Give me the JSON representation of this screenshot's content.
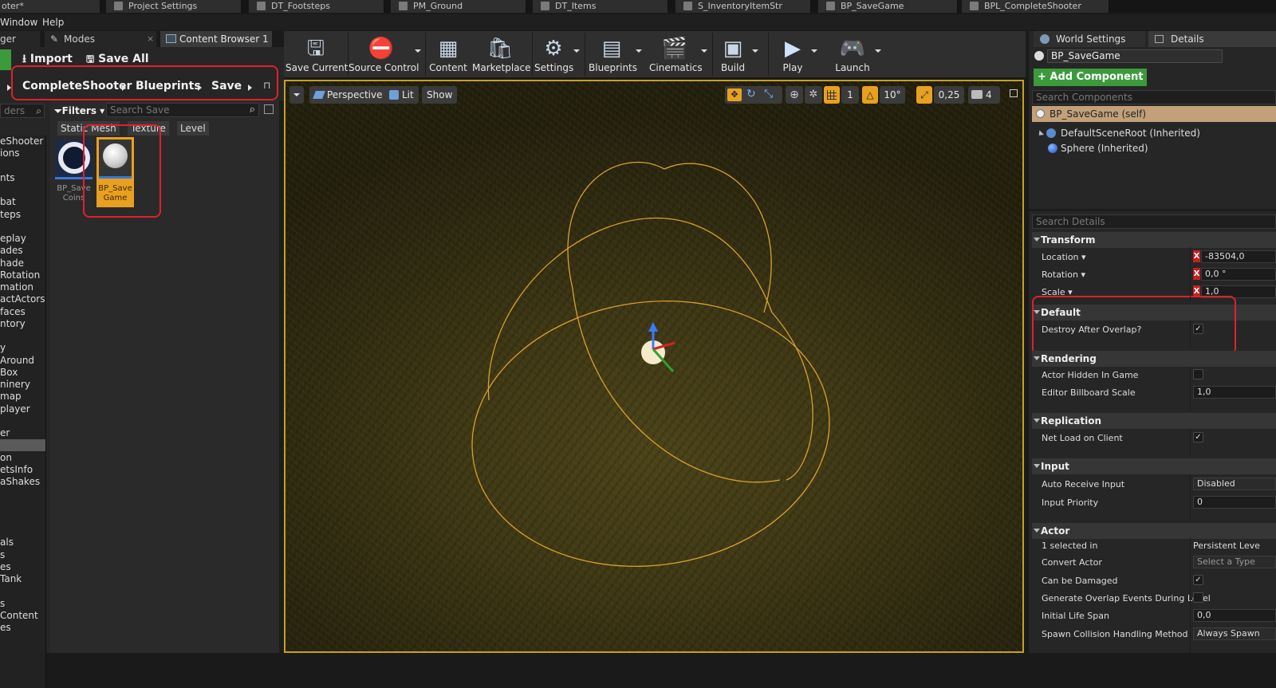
{
  "tabs": [
    {
      "label": "oter*"
    },
    {
      "label": "Project Settings"
    },
    {
      "label": "DT_Footsteps"
    },
    {
      "label": "PM_Ground"
    },
    {
      "label": "DT_Items"
    },
    {
      "label": "S_InventoryItemStr"
    },
    {
      "label": "BP_SaveGame"
    },
    {
      "label": "BPL_CompleteShooter"
    }
  ],
  "menu": [
    "Window",
    "Help"
  ],
  "left_panel": {
    "tabs": [
      "ger",
      "Modes",
      "Content Browser 1"
    ],
    "import_label": "Import",
    "save_all_label": "Save All",
    "breadcrumb": [
      "CompleteShooter",
      "Blueprints",
      "Save"
    ],
    "filters_label": "Filters",
    "search_placeholder": "Search Save",
    "folder_search_placeholder": "ders",
    "filter_chips": [
      "Static Mesh",
      "Texture",
      "Level"
    ],
    "tree": [
      "eShooter",
      "ions",
      "",
      "nts",
      "",
      "bat",
      "teps",
      "",
      "eplay",
      "ades",
      "hade",
      "Rotation",
      "mation",
      "actActors",
      "faces",
      "ntory",
      "",
      "y",
      "Around",
      "Box",
      "ninery",
      "map",
      "player",
      "",
      "er",
      "",
      "on",
      "etsInfo",
      "aShakes",
      "",
      "",
      "",
      "",
      "als",
      "s",
      "es",
      "Tank",
      "",
      "s",
      "Content",
      "es"
    ],
    "assets": [
      {
        "label": "BP_Save Coins",
        "line1": "BP_Save",
        "line2": "Coins"
      },
      {
        "label": "BP_Save Game",
        "line1": "BP_Save",
        "line2": "Game"
      }
    ]
  },
  "toolbar": {
    "buttons": [
      "Save Current",
      "Source Control",
      "Content",
      "Marketplace",
      "Settings",
      "Blueprints",
      "Cinematics",
      "Build",
      "Play",
      "Launch"
    ]
  },
  "viewport": {
    "perspective_label": "Perspective",
    "lit_label": "Lit",
    "show_label": "Show",
    "grid_snap": "1",
    "rotation_snap": "10°",
    "scale_snap": "0,25",
    "camera_speed": "4"
  },
  "right_panel": {
    "tabs": [
      "World Settings",
      "Details"
    ],
    "actor_name": "BP_SaveGame",
    "add_component_label": "+ Add Component",
    "search_components_placeholder": "Search Components",
    "components": [
      "BP_SaveGame (self)",
      "DefaultSceneRoot (Inherited)",
      "Sphere (Inherited)"
    ],
    "search_details_placeholder": "Search Details",
    "transform": {
      "title": "Transform",
      "location_label": "Location",
      "location_value": "-83504,0",
      "rotation_label": "Rotation",
      "rotation_value": "0,0 °",
      "scale_label": "Scale",
      "scale_value": "1,0"
    },
    "default": {
      "title": "Default",
      "destroy_label": "Destroy After Overlap?",
      "destroy_checked": true
    },
    "rendering": {
      "title": "Rendering",
      "hidden_label": "Actor Hidden In Game",
      "hidden_checked": false,
      "billboard_label": "Editor Billboard Scale",
      "billboard_value": "1,0"
    },
    "replication": {
      "title": "Replication",
      "net_load_label": "Net Load on Client",
      "net_load_checked": true
    },
    "input": {
      "title": "Input",
      "auto_receive_label": "Auto Receive Input",
      "auto_receive_value": "Disabled",
      "priority_label": "Input Priority",
      "priority_value": "0"
    },
    "actor": {
      "title": "Actor",
      "selected_label": "1 selected in",
      "selected_value": "Persistent Leve",
      "convert_label": "Convert Actor",
      "convert_value": "Select a Type",
      "damaged_label": "Can be Damaged",
      "damaged_checked": true,
      "overlap_label": "Generate Overlap Events During Level",
      "overlap_checked": false,
      "lifespan_label": "Initial Life Span",
      "lifespan_value": "0,0",
      "spawn_label": "Spawn Collision Handling Method",
      "spawn_value": "Always Spawn"
    }
  },
  "colors": {
    "highlight_red": "#e0202e",
    "selection_orange": "#e8a020",
    "add_component_green": "#3c9a3c"
  }
}
